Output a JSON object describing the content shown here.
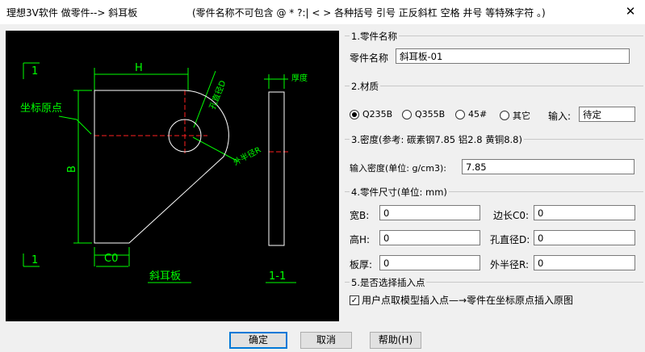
{
  "window": {
    "title": "理想3V软件 做零件--> 斜耳板",
    "note": "(零件名称不可包含 @ * ?:| < > 各种括号 引号 正反斜杠 空格 井号 等特殊字符 。)",
    "close_glyph": "✕"
  },
  "drawing": {
    "label_section_top": "1",
    "label_section_bottom": "1",
    "label_h": "H",
    "label_b": "B",
    "label_c0": "C0",
    "label_origin": "坐标原点",
    "label_hole": "孔直径D",
    "label_outer_radius": "外半径R",
    "label_thickness": "厚度",
    "label_title": "斜耳板",
    "label_section_view": "1-1"
  },
  "part_name": {
    "group_title": "1.零件名称",
    "label": "零件名称",
    "value": "斜耳板-01"
  },
  "material": {
    "group_title": "2.材质",
    "options": [
      "Q235B",
      "Q355B",
      "45#",
      "其它"
    ],
    "selected_index": 0,
    "input_label": "输入:",
    "input_value": "待定"
  },
  "density": {
    "group_title": "3.密度(参考: 碳素钢7.85  铝2.8  黄铜8.8)",
    "label": "输入密度(单位: g/cm3):",
    "value": "7.85"
  },
  "dimensions": {
    "group_title": "4.零件尺寸(单位: mm)",
    "width_label": "宽B:",
    "width_value": "0",
    "edge_label": "边长C0:",
    "edge_value": "0",
    "height_label": "高H:",
    "height_value": "0",
    "hole_label": "孔直径D:",
    "hole_value": "0",
    "thick_label": "板厚:",
    "thick_value": "0",
    "radius_label": "外半径R:",
    "radius_value": "0"
  },
  "insert": {
    "group_title": "5.是否选择插入点",
    "checkbox_label": "用户点取模型插入点—→零件在坐标原点插入原图",
    "checked": true,
    "check_glyph": "✓"
  },
  "buttons": {
    "ok": "确定",
    "cancel": "取消",
    "help": "帮助(H)"
  }
}
